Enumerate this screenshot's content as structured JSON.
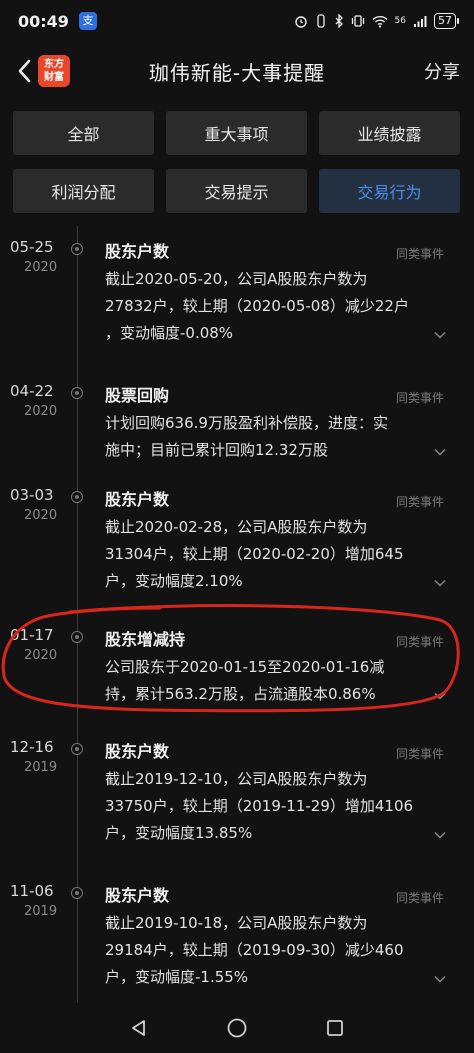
{
  "status": {
    "time": "00:49",
    "app_badge": "支",
    "signal": "56",
    "battery": "57"
  },
  "header": {
    "logo_line1": "东方",
    "logo_line2": "财富",
    "title": "珈伟新能-大事提醒",
    "share_label": "分享"
  },
  "filters": [
    {
      "label": "全部",
      "active": false
    },
    {
      "label": "重大事项",
      "active": false
    },
    {
      "label": "业绩披露",
      "active": false
    },
    {
      "label": "利润分配",
      "active": false
    },
    {
      "label": "交易提示",
      "active": false
    },
    {
      "label": "交易行为",
      "active": true
    }
  ],
  "events": [
    {
      "date": "05-25",
      "year": "2020",
      "title": "股东户数",
      "similar": "同类事件",
      "lines": [
        "截止2020-05-20，公司A股股东户数为",
        "27832户，较上期（2020-05-08）减少22户",
        "，变动幅度-0.08%"
      ]
    },
    {
      "date": "04-22",
      "year": "2020",
      "title": "股票回购",
      "similar": "同类事件",
      "lines": [
        "计划回购636.9万股盈利补偿股，进度：实",
        "施中；目前已累计回购12.32万股"
      ]
    },
    {
      "date": "03-03",
      "year": "2020",
      "title": "股东户数",
      "similar": "同类事件",
      "lines": [
        "截止2020-02-28，公司A股股东户数为",
        "31304户，较上期（2020-02-20）增加645",
        "户，变动幅度2.10%"
      ]
    },
    {
      "date": "01-17",
      "year": "2020",
      "title": "股东增减持",
      "similar": "同类事件",
      "lines": [
        "公司股东于2020-01-15至2020-01-16减",
        "持，累计563.2万股，占流通股本0.86%"
      ]
    },
    {
      "date": "12-16",
      "year": "2019",
      "title": "股东户数",
      "similar": "同类事件",
      "lines": [
        "截止2019-12-10，公司A股股东户数为",
        "33750户，较上期（2019-11-29）增加4106",
        "户，变动幅度13.85%"
      ]
    },
    {
      "date": "11-06",
      "year": "2019",
      "title": "股东户数",
      "similar": "同类事件",
      "lines": [
        "截止2019-10-18，公司A股股东户数为",
        "29184户，较上期（2019-09-30）减少460",
        "户，变动幅度-1.55%"
      ]
    }
  ],
  "colors": {
    "accent": "#4b8ee8",
    "highlight_ring": "#d9261c",
    "logo": "#e8472b"
  }
}
